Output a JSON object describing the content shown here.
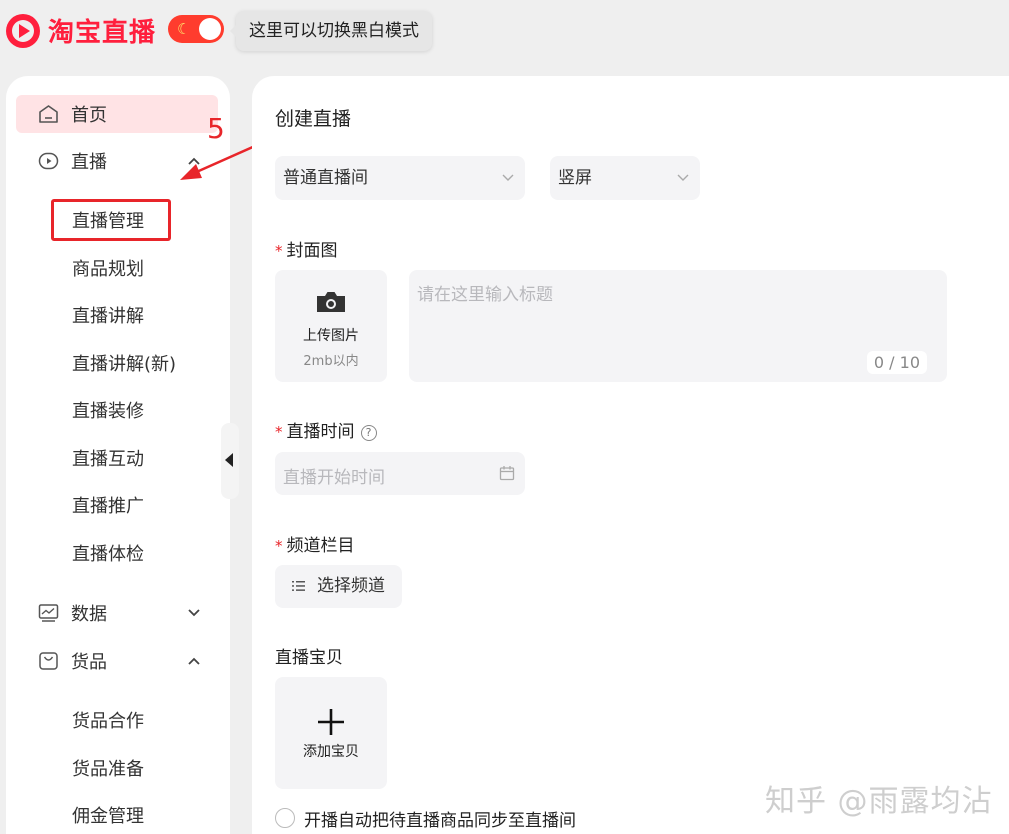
{
  "header": {
    "logo_text": "淘宝直播",
    "theme_toggle_icon": "moon-icon",
    "tooltip": "这里可以切换黑白模式"
  },
  "sidebar": {
    "home": "首页",
    "live": "直播",
    "live_subitems": [
      "直播管理",
      "商品规划",
      "直播讲解",
      "直播讲解(新)",
      "直播装修",
      "直播互动",
      "直播推广",
      "直播体检"
    ],
    "data": "数据",
    "goods": "货品",
    "goods_subitems": [
      "货品合作",
      "货品准备",
      "佣金管理"
    ]
  },
  "annotation": {
    "step_number": "5",
    "color": "#e8252a"
  },
  "form": {
    "title": "创建直播",
    "room_type": "普通直播间",
    "orientation": "竖屏",
    "cover_label": "封面图",
    "upload_title": "上传图片",
    "upload_hint": "2mb以内",
    "title_placeholder": "请在这里输入标题",
    "title_counter": "0 / 10",
    "time_label": "直播时间",
    "time_help": "?",
    "time_placeholder": "直播开始时间",
    "channel_label": "频道栏目",
    "channel_button": "选择频道",
    "products_label": "直播宝贝",
    "add_product": "添加宝贝",
    "sync_option": "开播自动把待直播商品同步至直播间",
    "required_mark": "*"
  },
  "watermark": "知乎 @雨露均沾",
  "colors": {
    "brand": "#ff1f3d",
    "active_bg": "#ffe3e5",
    "field_bg": "#f4f4f6"
  }
}
